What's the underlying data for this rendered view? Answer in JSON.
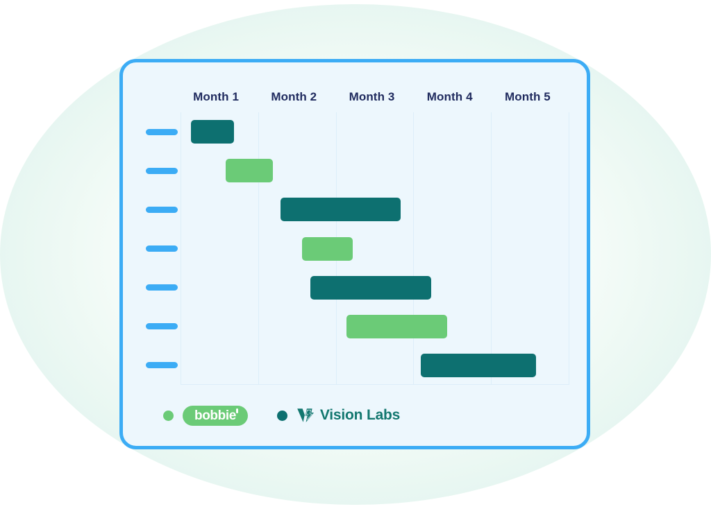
{
  "card": {
    "border_color": "#3CACF5",
    "background_color": "#EDF7FD"
  },
  "chart_data": {
    "type": "bar",
    "subtype": "gantt",
    "title": "",
    "xlabel": "",
    "ylabel": "",
    "grid": true,
    "legend_position": "bottom-left",
    "categories": [
      "Month 1",
      "Month 2",
      "Month 3",
      "Month 4",
      "Month 5"
    ],
    "xlim": [
      0,
      5
    ],
    "axis_unit": "month",
    "row_label_placeholder": "redacted",
    "rows": [
      {
        "index": 1,
        "label": "",
        "start": 0.13,
        "end": 0.69,
        "series": "Vision Labs",
        "color": "#0D7070"
      },
      {
        "index": 2,
        "label": "",
        "start": 0.58,
        "end": 1.19,
        "series": "bobbie",
        "color": "#6BCB77"
      },
      {
        "index": 3,
        "label": "",
        "start": 1.29,
        "end": 2.83,
        "series": "Vision Labs",
        "color": "#0D7070"
      },
      {
        "index": 4,
        "label": "",
        "start": 1.56,
        "end": 2.21,
        "series": "bobbie",
        "color": "#6BCB77"
      },
      {
        "index": 5,
        "label": "",
        "start": 1.67,
        "end": 3.22,
        "series": "Vision Labs",
        "color": "#0D7070"
      },
      {
        "index": 6,
        "label": "",
        "start": 2.13,
        "end": 3.43,
        "series": "bobbie",
        "color": "#6BCB77"
      },
      {
        "index": 7,
        "label": "",
        "start": 3.09,
        "end": 4.57,
        "series": "Vision Labs",
        "color": "#0D7070"
      }
    ],
    "series": [
      {
        "name": "bobbie",
        "color": "#6BCB77"
      },
      {
        "name": "Vision Labs",
        "color": "#0D7070"
      }
    ]
  },
  "legend": {
    "items": [
      {
        "name": "bobbie",
        "label": "bobbie",
        "dot_color": "#6BCB77",
        "logo_style": "pill",
        "logo_background": "#6BCB77",
        "logo_text_color": "#ffffff"
      },
      {
        "name": "Vision Labs",
        "label": "Vision Labs",
        "dot_color": "#0D7070",
        "logo_style": "mark-and-text",
        "logo_text_color": "#12776F",
        "mark_icon": "v-bolt-icon"
      }
    ]
  }
}
